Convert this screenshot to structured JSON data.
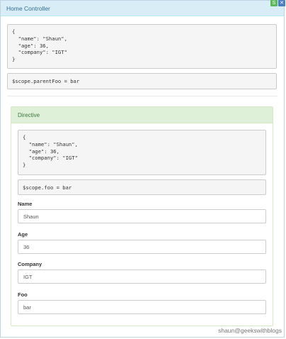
{
  "header": {
    "title": "Home Controller"
  },
  "corner_icons": [
    {
      "name": "refresh-icon",
      "glyph": "S",
      "color": "#5cb85c"
    },
    {
      "name": "close-icon",
      "glyph": "✕",
      "color": "#4a7fc1"
    }
  ],
  "home": {
    "json_dump": "{\n  \"name\": \"Shaun\",\n  \"age\": 36,\n  \"company\": \"IGT\"\n}",
    "scope_line": "$scope.parentFoo = bar"
  },
  "directive": {
    "title": "Directive",
    "json_dump": "{\n  \"name\": \"Shaun\",\n  \"age\": 36,\n  \"company\": \"IGT\"\n}",
    "scope_line": "$scope.foo = bar",
    "fields": [
      {
        "label": "Name",
        "value": "Shaun"
      },
      {
        "label": "Age",
        "value": "36"
      },
      {
        "label": "Company",
        "value": "IGT"
      },
      {
        "label": "Foo",
        "value": "bar"
      }
    ]
  },
  "watermark": "shaun@geekswithblogs",
  "colors": {
    "header_bg": "#d9edf7",
    "header_text": "#31708f",
    "panel_heading_bg": "#dff0d8",
    "panel_heading_text": "#3c763d",
    "well_bg": "#f5f5f5"
  }
}
